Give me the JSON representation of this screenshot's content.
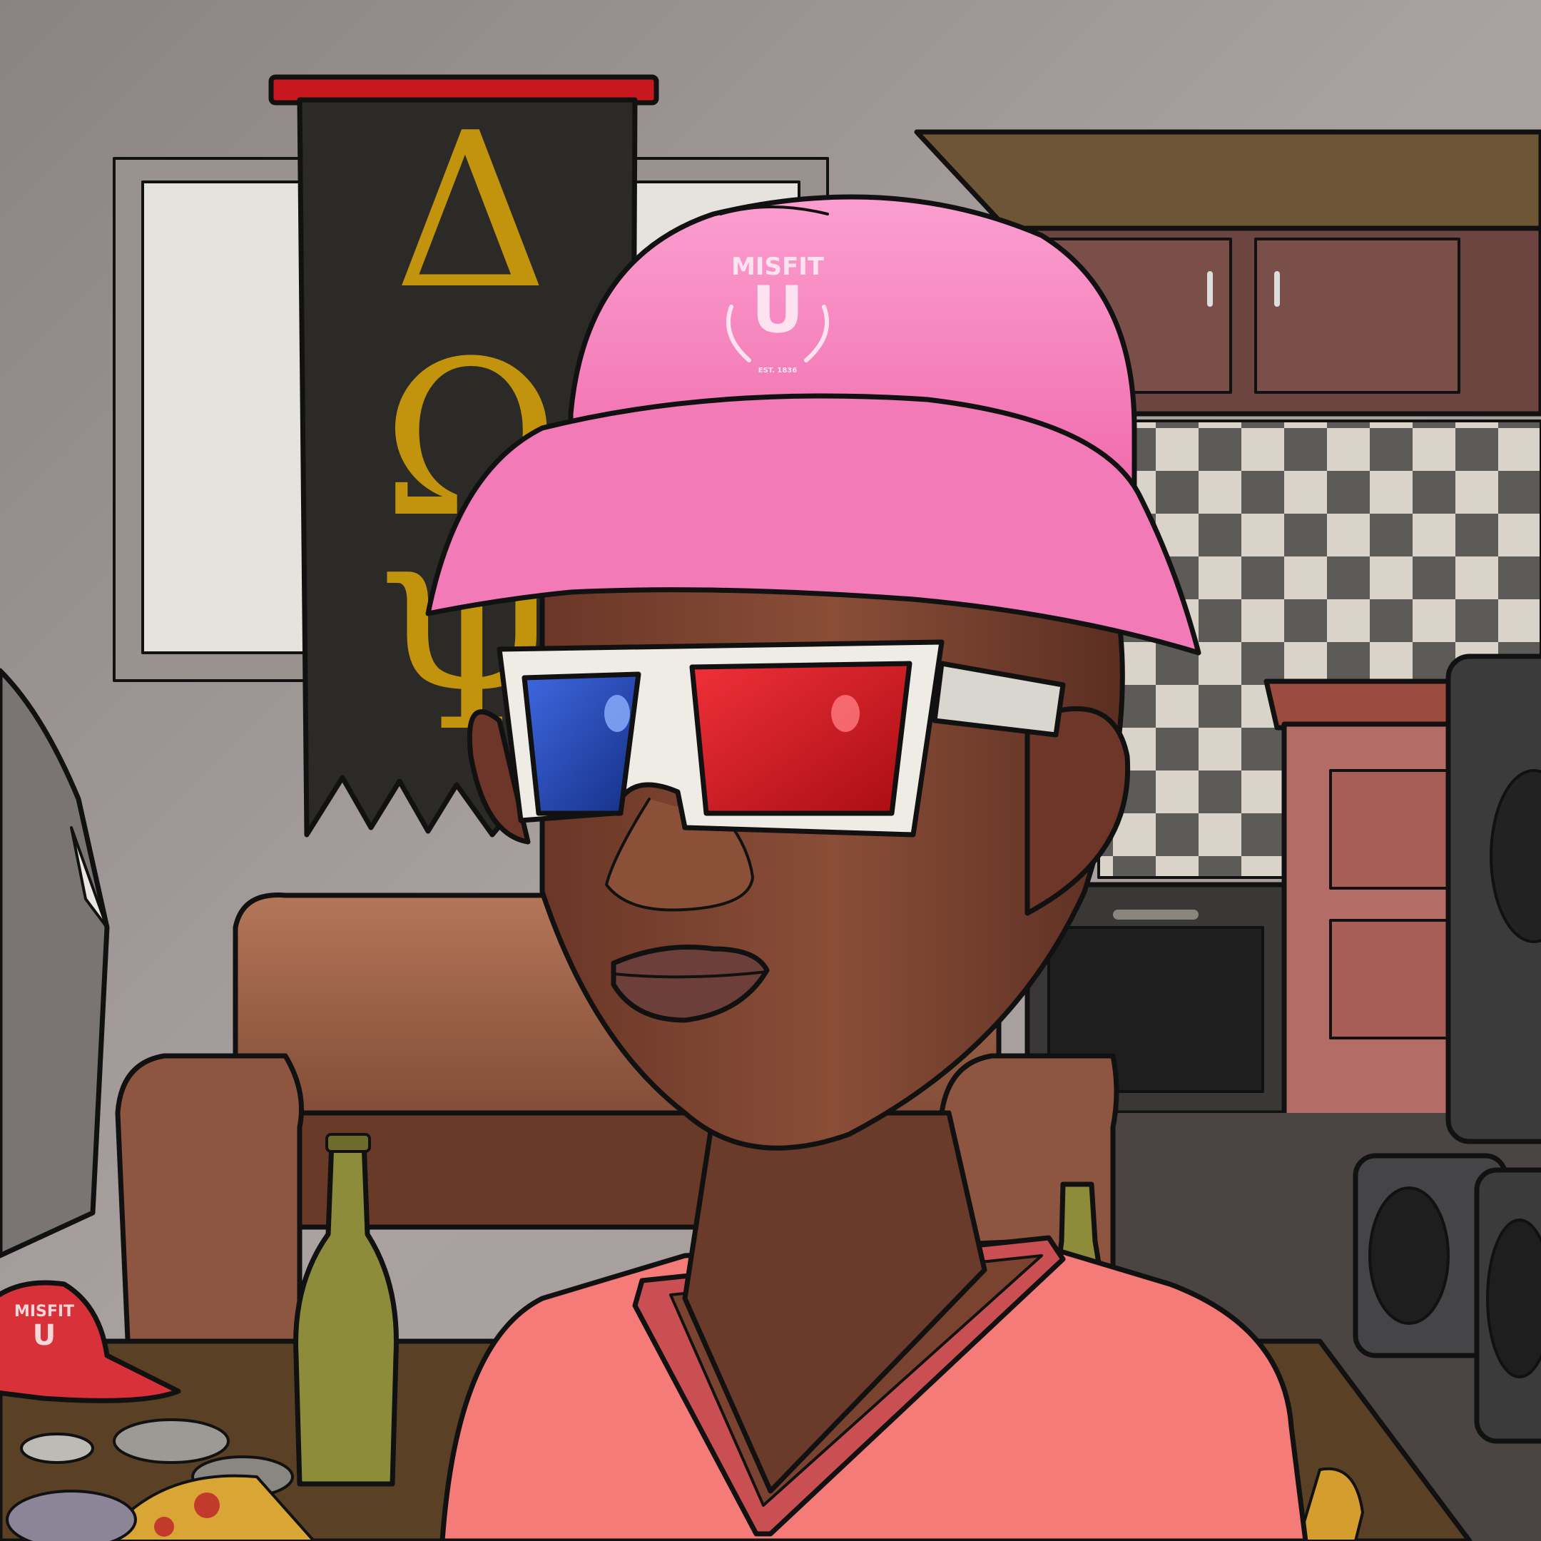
{
  "banner": {
    "letters": [
      "Δ",
      "Ω",
      "Ψ"
    ],
    "letter_color": "#c2930c",
    "cloth_color": "#2b2a27",
    "rod_color": "#c8181f"
  },
  "cap": {
    "color": "#f47db6",
    "logo_top": "MISFIT",
    "logo_letter": "U",
    "logo_est": "EST. 1836"
  },
  "table_cap": {
    "color": "#d9313a",
    "logo_top": "MISFIT",
    "logo_letter": "U"
  },
  "glasses": {
    "frame_color": "#eeece4",
    "left_lens": "#1b3fa8",
    "right_lens": "#d1131a"
  },
  "shirt": {
    "color": "#f57b78"
  },
  "skin": {
    "color": "#7a4330"
  },
  "wall": {
    "color": "#a59c9b"
  }
}
